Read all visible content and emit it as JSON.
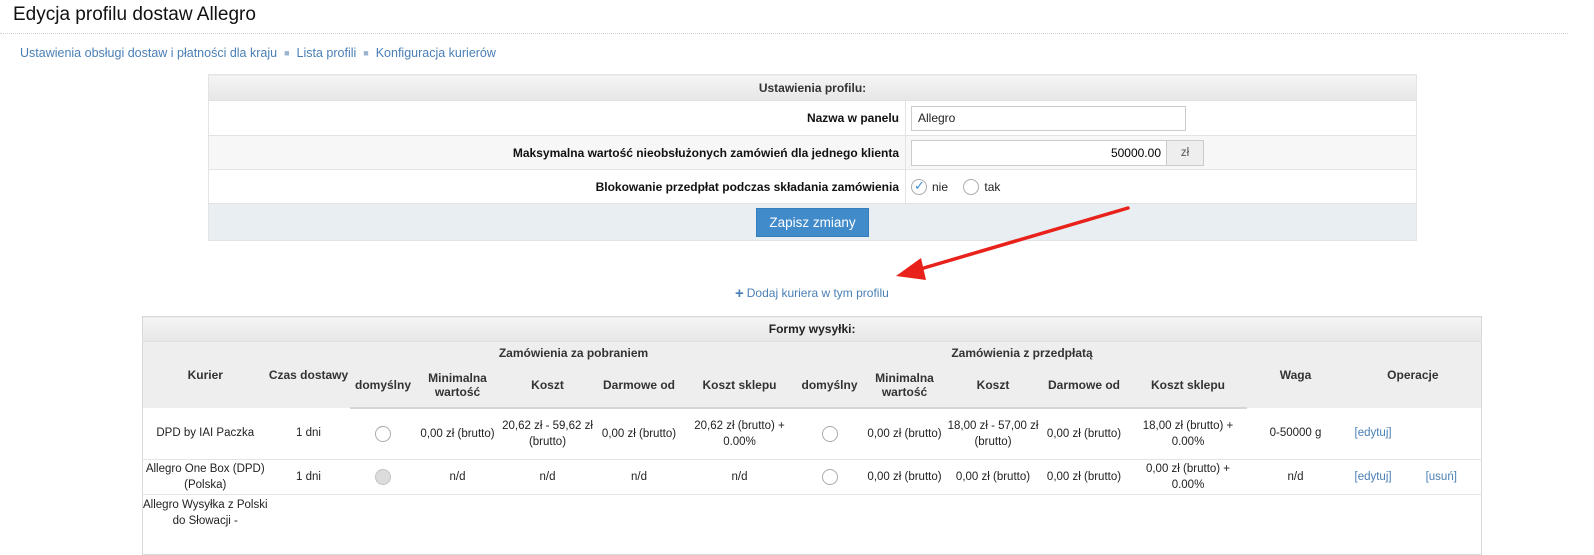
{
  "page": {
    "title": "Edycja profilu dostaw Allegro"
  },
  "breadcrumb": [
    {
      "label": "Ustawienia obsługi dostaw i płatności dla kraju"
    },
    {
      "label": "Lista profili"
    },
    {
      "label": "Konfiguracja kurierów"
    }
  ],
  "settings": {
    "header": "Ustawienia profilu:",
    "name_label": "Nazwa w panelu",
    "name_value": "Allegro",
    "max_label": "Maksymalna wartość nieobsłużonych zamówień dla jednego klienta",
    "max_value": "50000.00",
    "max_unit": "zł",
    "block_label": "Blokowanie przedpłat podczas składania zamówienia",
    "block_options": [
      {
        "label": "nie",
        "checked": true
      },
      {
        "label": "tak",
        "checked": false
      }
    ],
    "save_label": "Zapisz zmiany"
  },
  "add_courier": {
    "label": "Dodaj kuriera w tym profilu"
  },
  "forms": {
    "header": "Formy wysyłki:",
    "col_courier": "Kurier",
    "col_time": "Czas dostawy",
    "group_cod": "Zamówienia za pobraniem",
    "group_prepaid": "Zamówienia z przedpłatą",
    "col_weight": "Waga",
    "col_ops": "Operacje",
    "sub": {
      "default": "domyślny",
      "min_value": "Minimalna wartość",
      "cost": "Koszt",
      "free_from": "Darmowe od",
      "shop_cost": "Koszt sklepu"
    },
    "rows": [
      {
        "courier": "DPD by IAI Paczka",
        "time": "1 dni",
        "cod": {
          "min": "0,00 zł (brutto)",
          "cost": "20,62 zł - 59,62 zł (brutto)",
          "free": "0,00 zł (brutto)",
          "shop": "20,62 zł (brutto) + 0.00%"
        },
        "pre": {
          "min": "0,00 zł (brutto)",
          "cost": "18,00 zł - 57,00 zł (brutto)",
          "free": "0,00 zł (brutto)",
          "shop": "18,00 zł (brutto) + 0.00%"
        },
        "weight": "0-50000 g",
        "edit": "[edytuj]",
        "delete": ""
      },
      {
        "courier": "Allegro One Box (DPD) (Polska)",
        "time": "1 dni",
        "cod": {
          "min": "n/d",
          "cost": "n/d",
          "free": "n/d",
          "shop": "n/d"
        },
        "pre": {
          "min": "0,00 zł (brutto)",
          "cost": "0,00 zł (brutto)",
          "free": "0,00 zł (brutto)",
          "shop": "0,00 zł (brutto) + 0.00%"
        },
        "weight": "n/d",
        "edit": "[edytuj]",
        "delete": "[usuń]"
      },
      {
        "courier": "Allegro Wysyłka z Polski do Słowacji -",
        "time": "",
        "cod": {
          "min": "",
          "cost": "",
          "free": "",
          "shop": ""
        },
        "pre": {
          "min": "",
          "cost": "",
          "free": "",
          "shop": ""
        },
        "weight": "",
        "edit": "",
        "delete": ""
      }
    ]
  },
  "colors": {
    "link": "#4a7fb5",
    "button": "#428bca",
    "arrow": "#e8221b"
  }
}
